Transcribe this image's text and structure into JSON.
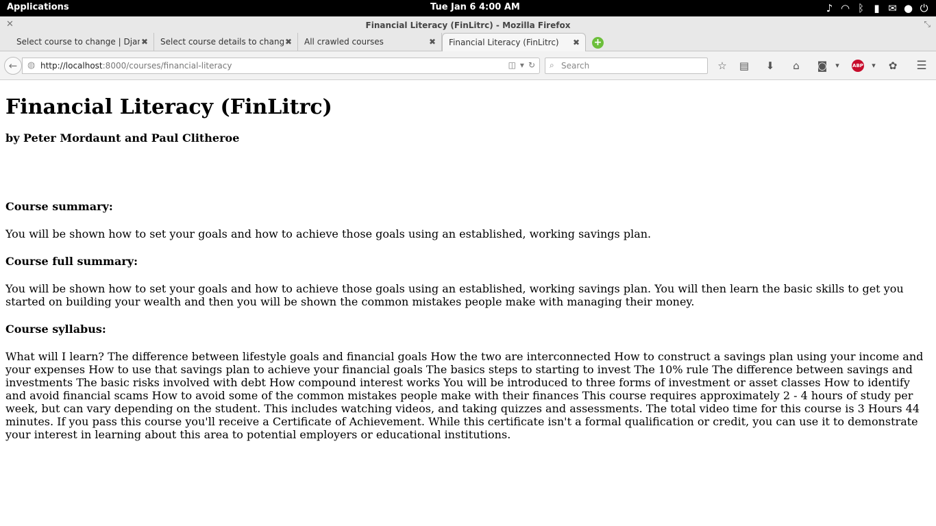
{
  "system_panel": {
    "applications_label": "Applications",
    "clock": "Tue Jan  6  4:00 AM",
    "tray_icons": [
      "volume-icon",
      "wifi-icon",
      "bluetooth-icon",
      "battery-icon",
      "mail-icon",
      "user-icon",
      "power-icon"
    ]
  },
  "window": {
    "title": "Financial Literacy (FinLitrc) - Mozilla Firefox"
  },
  "tabs": [
    {
      "label": "Select course to change | Djan..."
    },
    {
      "label": "Select course details to change..."
    },
    {
      "label": "All crawled courses"
    },
    {
      "label": "Financial Literacy (FinLitrc)"
    }
  ],
  "navbar": {
    "url_host": "http://localhost",
    "url_rest": ":8000/courses/financial-literacy",
    "search_placeholder": "Search",
    "adblock_label": "ABP"
  },
  "page": {
    "title": "Financial Literacy (FinLitrc)",
    "authors": "by Peter Mordaunt and Paul Clitheroe",
    "summary_heading": "Course summary:",
    "summary_text": "You will be shown how to set your goals and how to achieve those goals using an established, working savings plan.",
    "full_summary_heading": "Course full summary:",
    "full_summary_text": "You will be shown how to set your goals and how to achieve those goals using an established, working savings plan. You will then learn the basic skills to get you started on building your wealth and then you will be shown the common mistakes people make with managing their money.",
    "syllabus_heading": "Course syllabus:",
    "syllabus_text": "What will I learn? The difference between lifestyle goals and financial goals How the two are interconnected How to construct a savings plan using your income and your expenses How to use that savings plan to achieve your financial goals The basics steps to starting to invest The 10% rule The difference between savings and investments The basic risks involved with debt How compound interest works You will be introduced to three forms of investment or asset classes How to identify and avoid financial scams How to avoid some of the common mistakes people make with their finances This course requires approximately 2 - 4 hours of study per week, but can vary depending on the student. This includes watching videos, and taking quizzes and assessments. The total video time for this course is 3 Hours 44 minutes. If you pass this course you'll receive a Certificate of Achievement. While this certificate isn't a formal qualification or credit, you can use it to demonstrate your interest in learning about this area to potential employers or educational institutions."
  }
}
